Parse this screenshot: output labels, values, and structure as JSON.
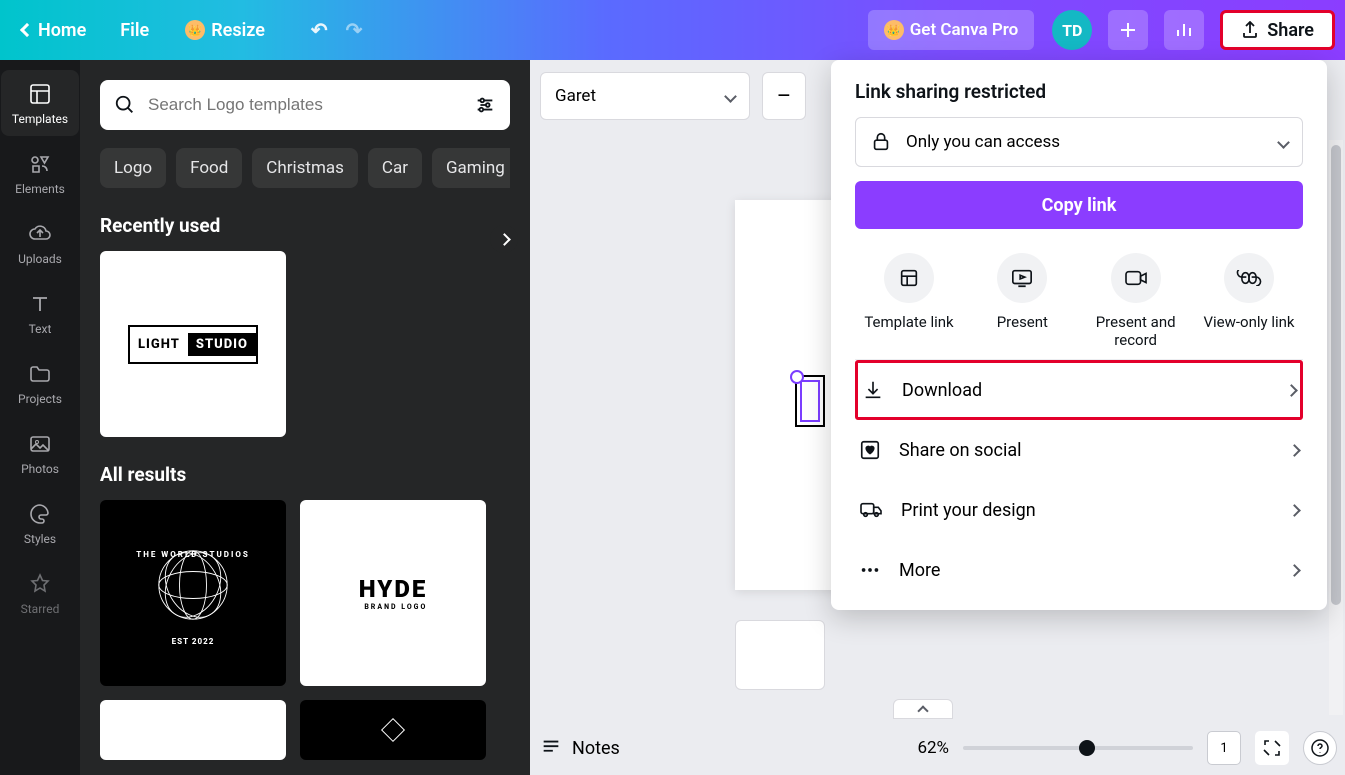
{
  "topbar": {
    "home": "Home",
    "file": "File",
    "resize": "Resize",
    "getpro": "Get Canva Pro",
    "avatar": "TD",
    "share": "Share"
  },
  "rail": {
    "templates": "Templates",
    "elements": "Elements",
    "uploads": "Uploads",
    "text": "Text",
    "projects": "Projects",
    "photos": "Photos",
    "styles": "Styles",
    "starred": "Starred"
  },
  "panel": {
    "search_placeholder": "Search Logo templates",
    "tags": {
      "logo": "Logo",
      "food": "Food",
      "christmas": "Christmas",
      "car": "Car",
      "gaming": "Gaming"
    },
    "recent": "Recently used",
    "allresults": "All results",
    "light": "LIGHT",
    "studio": "STUDIO",
    "hyde": "HYDE",
    "hyde_sub": "BRAND LOGO",
    "world1": "THE WORLD STUDIOS",
    "world2": "EST 2022"
  },
  "toolbar": {
    "font": "Garet",
    "minus": "–"
  },
  "sharepop": {
    "title": "Link sharing restricted",
    "access": "Only you can access",
    "copy": "Copy link",
    "template": "Template link",
    "present": "Present",
    "presentrecord": "Present and record",
    "viewonly": "View-only link",
    "download": "Download",
    "social": "Share on social",
    "print": "Print your design",
    "more": "More"
  },
  "bottom": {
    "notes": "Notes",
    "zoom": "62%",
    "page": "1"
  }
}
